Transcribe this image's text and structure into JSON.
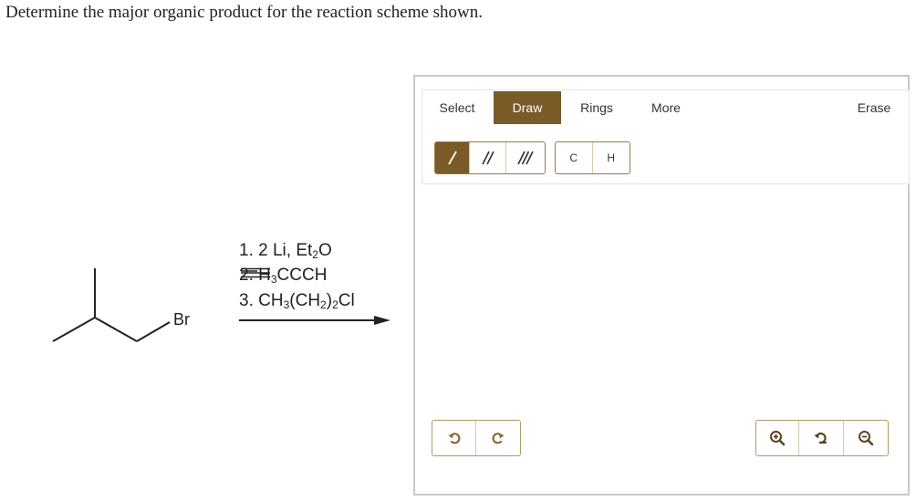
{
  "question": "Determine the major organic product for the reaction scheme shown.",
  "scheme": {
    "halide_label": "Br",
    "step1": {
      "prefix": "1. 2 Li, Et",
      "sub": "2",
      "suffix": "O"
    },
    "step2": {
      "prefix": "2. H",
      "sub": "3",
      "c1": "C",
      "c2": "C",
      "end": "CH"
    },
    "step3": {
      "prefix": "3. CH",
      "sub1": "3",
      "mid": "(CH",
      "sub2": "2",
      "mid2": ")",
      "sub3": "2",
      "end": "Cl"
    }
  },
  "editor": {
    "tabs": {
      "select": "Select",
      "draw": "Draw",
      "rings": "Rings",
      "more": "More",
      "erase": "Erase"
    },
    "active_tab": "Draw",
    "atoms": {
      "carbon": "C",
      "hydrogen": "H"
    }
  },
  "colors": {
    "accent": "#7a5a26",
    "icon": "#8a6a2e"
  }
}
